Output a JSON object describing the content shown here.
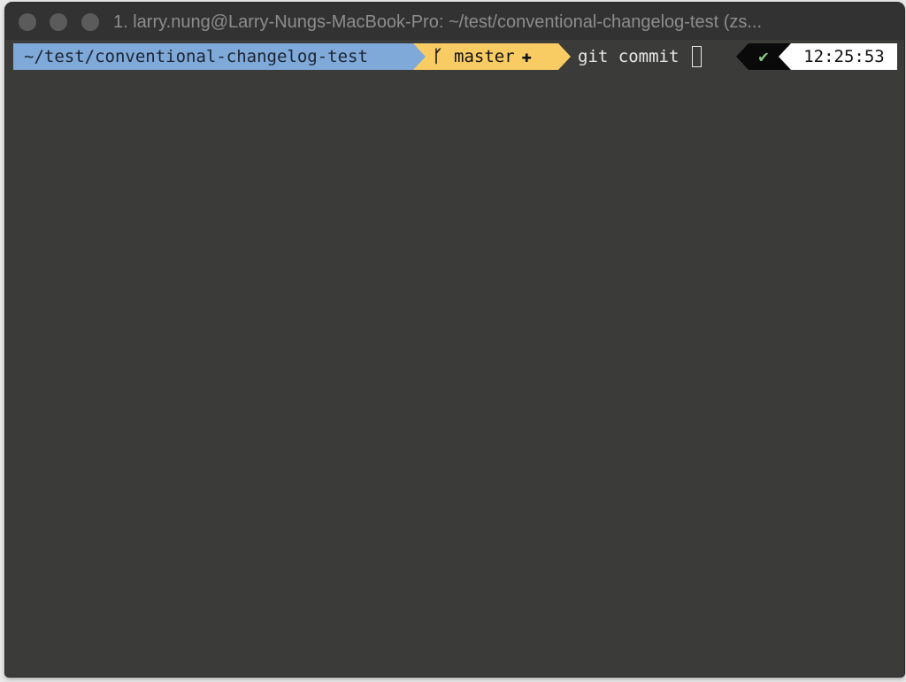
{
  "window": {
    "title": "1. larry.nung@Larry-Nungs-MacBook-Pro: ~/test/conventional-changelog-test (zs..."
  },
  "prompt": {
    "directory": "~/test/conventional-changelog-test",
    "branch_icon": "branch-icon",
    "branch_glyph": "ᚴ",
    "branch": "master",
    "dirty_icon": "plus-icon",
    "dirty_glyph": "✚",
    "command": "git commit",
    "status_icon": "check-icon",
    "status_glyph": "✔",
    "time": "12:25:53"
  },
  "colors": {
    "terminal_bg": "#3b3b39",
    "dir_segment": "#7fa9d8",
    "git_segment": "#f9cc63",
    "status_segment": "#0a0a0a",
    "status_ok": "#86c983",
    "time_segment": "#ffffff"
  }
}
